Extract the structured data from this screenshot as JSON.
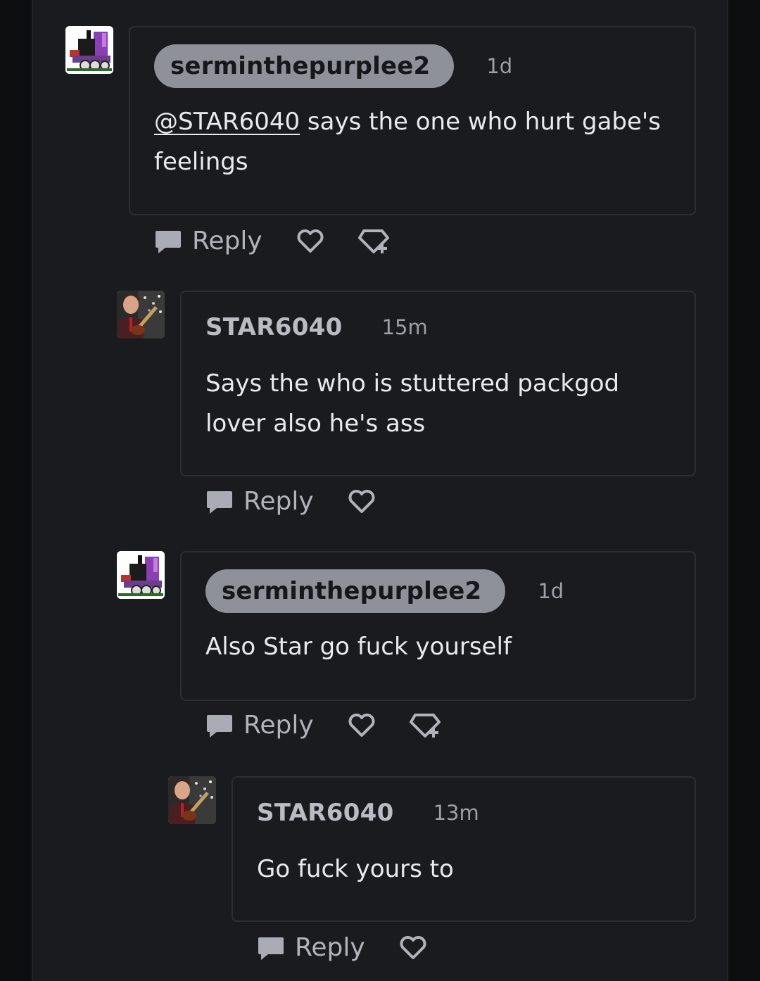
{
  "comments": [
    {
      "username": "serminthepurplee2",
      "time": "1d",
      "mention": "@STAR6040",
      "text": " says the one who hurt gabe's feelings",
      "reply_label": "Reply",
      "avatar_icon": "engine-avatar-icon",
      "has_award": true
    },
    {
      "username": "STAR6040",
      "time": "15m",
      "text": "Says the who is stuttered packgod lover also he's ass",
      "reply_label": "Reply",
      "avatar_icon": "portrait-guitar-avatar-icon",
      "has_award": false
    },
    {
      "username": "serminthepurplee2",
      "time": "1d",
      "text": "Also Star go fuck yourself",
      "reply_label": "Reply",
      "avatar_icon": "engine-avatar-icon",
      "has_award": true
    },
    {
      "username": "STAR6040",
      "time": "13m",
      "text": "Go fuck yours to",
      "reply_label": "Reply",
      "avatar_icon": "portrait-guitar-avatar-icon",
      "has_award": false
    }
  ],
  "colors": {
    "background": "#1a1b1f",
    "pill": "#8f9199",
    "card_border": "#2c2e34"
  }
}
